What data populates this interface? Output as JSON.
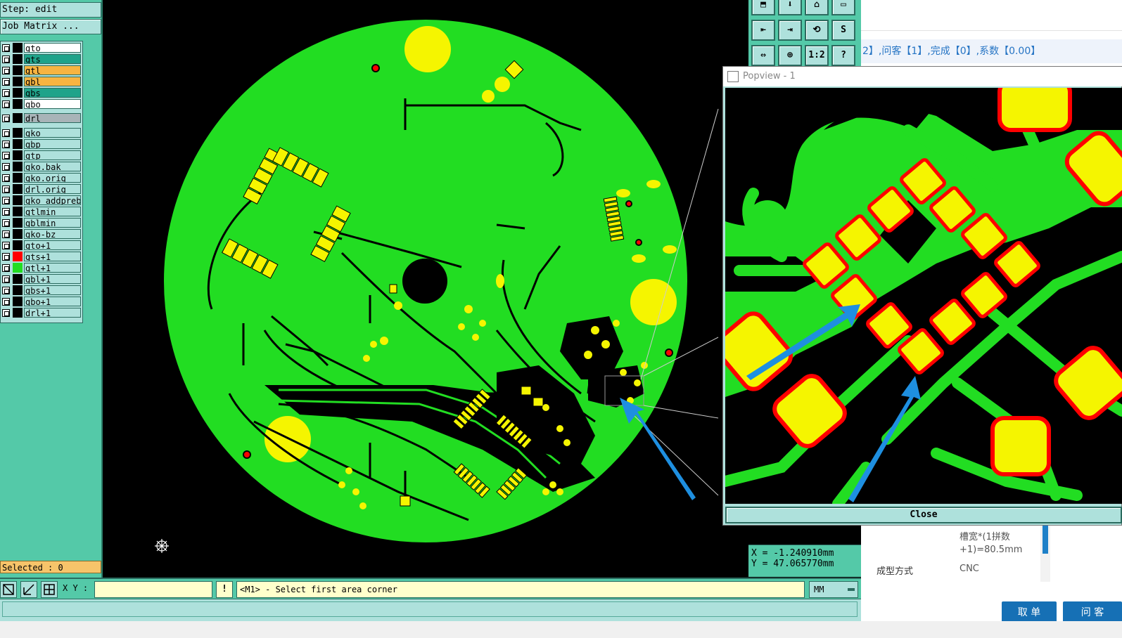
{
  "left_panel": {
    "step": "Step: edit",
    "job_matrix": "Job Matrix ...",
    "selected": "Selected : 0",
    "layers": [
      {
        "name": "gto",
        "bg": "#ffffff",
        "swatch": "#000000"
      },
      {
        "name": "gts",
        "bg": "#1fa38a",
        "swatch": "#000000"
      },
      {
        "name": "gtl",
        "bg": "#f7b441",
        "swatch": "#000000"
      },
      {
        "name": "gbl",
        "bg": "#f7b441",
        "swatch": "#000000"
      },
      {
        "name": "gbs",
        "bg": "#1fa38a",
        "swatch": "#000000"
      },
      {
        "name": "gbo",
        "bg": "#ffffff",
        "swatch": "#000000"
      },
      {
        "name": "drl",
        "bg": "#a8b4b8",
        "swatch": "#000000"
      },
      {
        "name": "gko",
        "bg": "#aee1dc",
        "swatch": "#000000"
      },
      {
        "name": "gbp",
        "bg": "#aee1dc",
        "swatch": "#000000"
      },
      {
        "name": "gtp",
        "bg": "#aee1dc",
        "swatch": "#000000"
      },
      {
        "name": "gko.bak",
        "bg": "#aee1dc",
        "swatch": "#000000"
      },
      {
        "name": "gko.orig",
        "bg": "#aee1dc",
        "swatch": "#000000"
      },
      {
        "name": "drl.orig",
        "bg": "#aee1dc",
        "swatch": "#000000"
      },
      {
        "name": "gko_addpreb",
        "bg": "#aee1dc",
        "swatch": "#000000"
      },
      {
        "name": "gtlmin",
        "bg": "#aee1dc",
        "swatch": "#000000"
      },
      {
        "name": "gblmin",
        "bg": "#aee1dc",
        "swatch": "#000000"
      },
      {
        "name": "gko-bz",
        "bg": "#aee1dc",
        "swatch": "#000000"
      },
      {
        "name": "gto+1",
        "bg": "#aee1dc",
        "swatch": "#000000"
      },
      {
        "name": "gts+1",
        "bg": "#aee1dc",
        "swatch": "#ff0000"
      },
      {
        "name": "gtl+1",
        "bg": "#aee1dc",
        "swatch": "#22dd22"
      },
      {
        "name": "gbl+1",
        "bg": "#aee1dc",
        "swatch": "#000000"
      },
      {
        "name": "gbs+1",
        "bg": "#aee1dc",
        "swatch": "#000000"
      },
      {
        "name": "gbo+1",
        "bg": "#aee1dc",
        "swatch": "#000000"
      },
      {
        "name": "drl+1",
        "bg": "#aee1dc",
        "swatch": "#000000"
      }
    ]
  },
  "toolbar": {
    "buttons": [
      "⬒",
      "⬇",
      "⌂",
      "▭",
      "⇤",
      "⇥",
      "⟲",
      "S",
      "⇔",
      "⊕",
      "1:2",
      "?"
    ]
  },
  "coords": {
    "x": "X = -1.240910mm",
    "y": "Y = 47.065770mm"
  },
  "command_bar": {
    "xy_label": "X Y :",
    "input_value": "",
    "warn": "!",
    "prompt": "<M1> - Select first area corner",
    "units": "MM"
  },
  "popview": {
    "title": "Popview - 1",
    "close_label": "Close"
  },
  "right_app": {
    "status_text": "2】,问客【1】,完成【0】,系数【0.00】",
    "slot_width_label": "槽宽*(1拼数",
    "slot_width_value": "+1)=80.5mm",
    "forming_label": "成型方式",
    "forming_value": "CNC",
    "cancel_button": "取 单",
    "ask_button": "问 客"
  },
  "colors": {
    "panel": "#54c9a8",
    "panel_light": "#aee1dc",
    "board_green": "#22dd22",
    "pad_yellow": "#f5f500",
    "mask_red": "#ff0000",
    "arrow_blue": "#1e8fe0"
  }
}
